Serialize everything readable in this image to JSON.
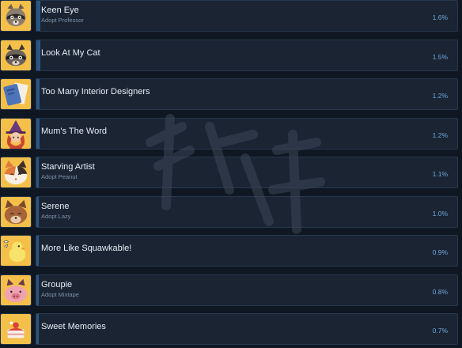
{
  "achievements": [
    {
      "title": "Keen Eye",
      "desc": "Adopt Professor",
      "pct": "1.6%",
      "rate": 1.6,
      "icon": "raccoon-icon",
      "bg": "#f5c04a"
    },
    {
      "title": "Look At My Cat",
      "desc": "",
      "pct": "1.5%",
      "rate": 1.5,
      "icon": "raccoon-cat-icon",
      "bg": "#f5c04a"
    },
    {
      "title": "Too Many Interior Designers",
      "desc": "",
      "pct": "1.2%",
      "rate": 1.2,
      "icon": "book-icon",
      "bg": "#f5c04a"
    },
    {
      "title": "Mum's The Word",
      "desc": "",
      "pct": "1.2%",
      "rate": 1.2,
      "icon": "witch-icon",
      "bg": "#f5c04a"
    },
    {
      "title": "Starving Artist",
      "desc": "Adopt Peanut",
      "pct": "1.1%",
      "rate": 1.1,
      "icon": "calico-cat-icon",
      "bg": "#f5c04a"
    },
    {
      "title": "Serene",
      "desc": "Adopt Lazy",
      "pct": "1.0%",
      "rate": 1.0,
      "icon": "brown-cat-icon",
      "bg": "#f5c04a"
    },
    {
      "title": "More Like Squawkable!",
      "desc": "",
      "pct": "0.9%",
      "rate": 0.9,
      "icon": "chick-icon",
      "bg": "#f5c04a"
    },
    {
      "title": "Groupie",
      "desc": "Adopt Mixtape",
      "pct": "0.8%",
      "rate": 0.8,
      "icon": "pig-icon",
      "bg": "#f5c04a"
    },
    {
      "title": "Sweet Memories",
      "desc": "",
      "pct": "0.7%",
      "rate": 0.7,
      "icon": "cake-icon",
      "bg": "#f5c04a"
    }
  ],
  "colors": {
    "panel": "#1a2433",
    "bar": "#2a5582",
    "percent": "#6fa8dc",
    "icon_bg": "#f5c04a"
  }
}
